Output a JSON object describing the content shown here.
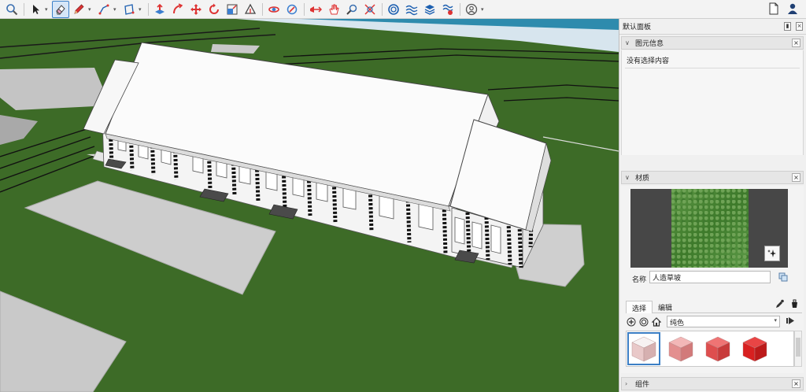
{
  "toolbar": {
    "tools": [
      {
        "name": "zoom-tool",
        "icon": "magnifier-icon"
      },
      {
        "name": "select-tool",
        "icon": "arrow-cursor-icon",
        "dropdown": true
      },
      {
        "name": "eraser-tool",
        "icon": "eraser-icon",
        "active": true
      },
      {
        "name": "pencil-tool",
        "icon": "pencil-icon",
        "dropdown": true
      },
      {
        "name": "line-tool",
        "icon": "line-icon",
        "dropdown": true
      },
      {
        "name": "shape-tool",
        "icon": "rectangle-icon",
        "dropdown": true
      },
      {
        "name": "push-pull-tool",
        "icon": "push-pull-icon"
      },
      {
        "name": "follow-me-tool",
        "icon": "follow-me-icon"
      },
      {
        "name": "move-tool",
        "icon": "move-icon"
      },
      {
        "name": "rotate-tool",
        "icon": "rotate-icon"
      },
      {
        "name": "scale-tool",
        "icon": "scale-icon"
      },
      {
        "name": "protractor-tool",
        "icon": "protractor-icon"
      },
      {
        "name": "orbit-tool",
        "icon": "orbit-icon"
      },
      {
        "name": "position-camera-tool",
        "icon": "camera-icon"
      },
      {
        "name": "section-plane-tool",
        "icon": "section-plane-icon"
      },
      {
        "name": "pan-tool",
        "icon": "hand-icon"
      },
      {
        "name": "zoom-window-tool",
        "icon": "zoom-window-icon"
      },
      {
        "name": "zoom-extents-tool",
        "icon": "zoom-extents-icon"
      },
      {
        "name": "warehouse-tool",
        "icon": "warehouse-icon"
      },
      {
        "name": "sandbox-tool",
        "icon": "sandbox-icon"
      },
      {
        "name": "layers-tool",
        "icon": "layers-icon"
      },
      {
        "name": "extension-tool",
        "icon": "extension-icon"
      },
      {
        "name": "account-tool",
        "icon": "user-circle-icon",
        "dropdown": true
      }
    ],
    "right": [
      {
        "name": "new-file-button",
        "icon": "document-icon"
      },
      {
        "name": "user-button",
        "icon": "person-icon"
      }
    ]
  },
  "panel": {
    "title": "默认面板",
    "entity_info": {
      "title": "图元信息",
      "message": "没有选择内容"
    },
    "materials": {
      "title": "材质",
      "name_label": "名称",
      "name_value": "人造草坡",
      "tabs": [
        "选择",
        "编辑"
      ],
      "selected_tab": 0,
      "library": "纯色",
      "swatches": [
        {
          "top": "#f7f2f2",
          "left": "#e9c9c9",
          "right": "#d6b0b0"
        },
        {
          "top": "#f3b7b7",
          "left": "#e38f8f",
          "right": "#d27a7a"
        },
        {
          "top": "#ef7474",
          "left": "#de4e4e",
          "right": "#c83b3b"
        },
        {
          "top": "#e94545",
          "left": "#d82020",
          "right": "#bc1a1a"
        }
      ]
    },
    "components": {
      "title": "组件"
    }
  },
  "colors": {
    "grass": "#3f6a28",
    "pavement": "#cfcfcf",
    "water": "#2f8db0",
    "selection": "#3c7fc5"
  }
}
